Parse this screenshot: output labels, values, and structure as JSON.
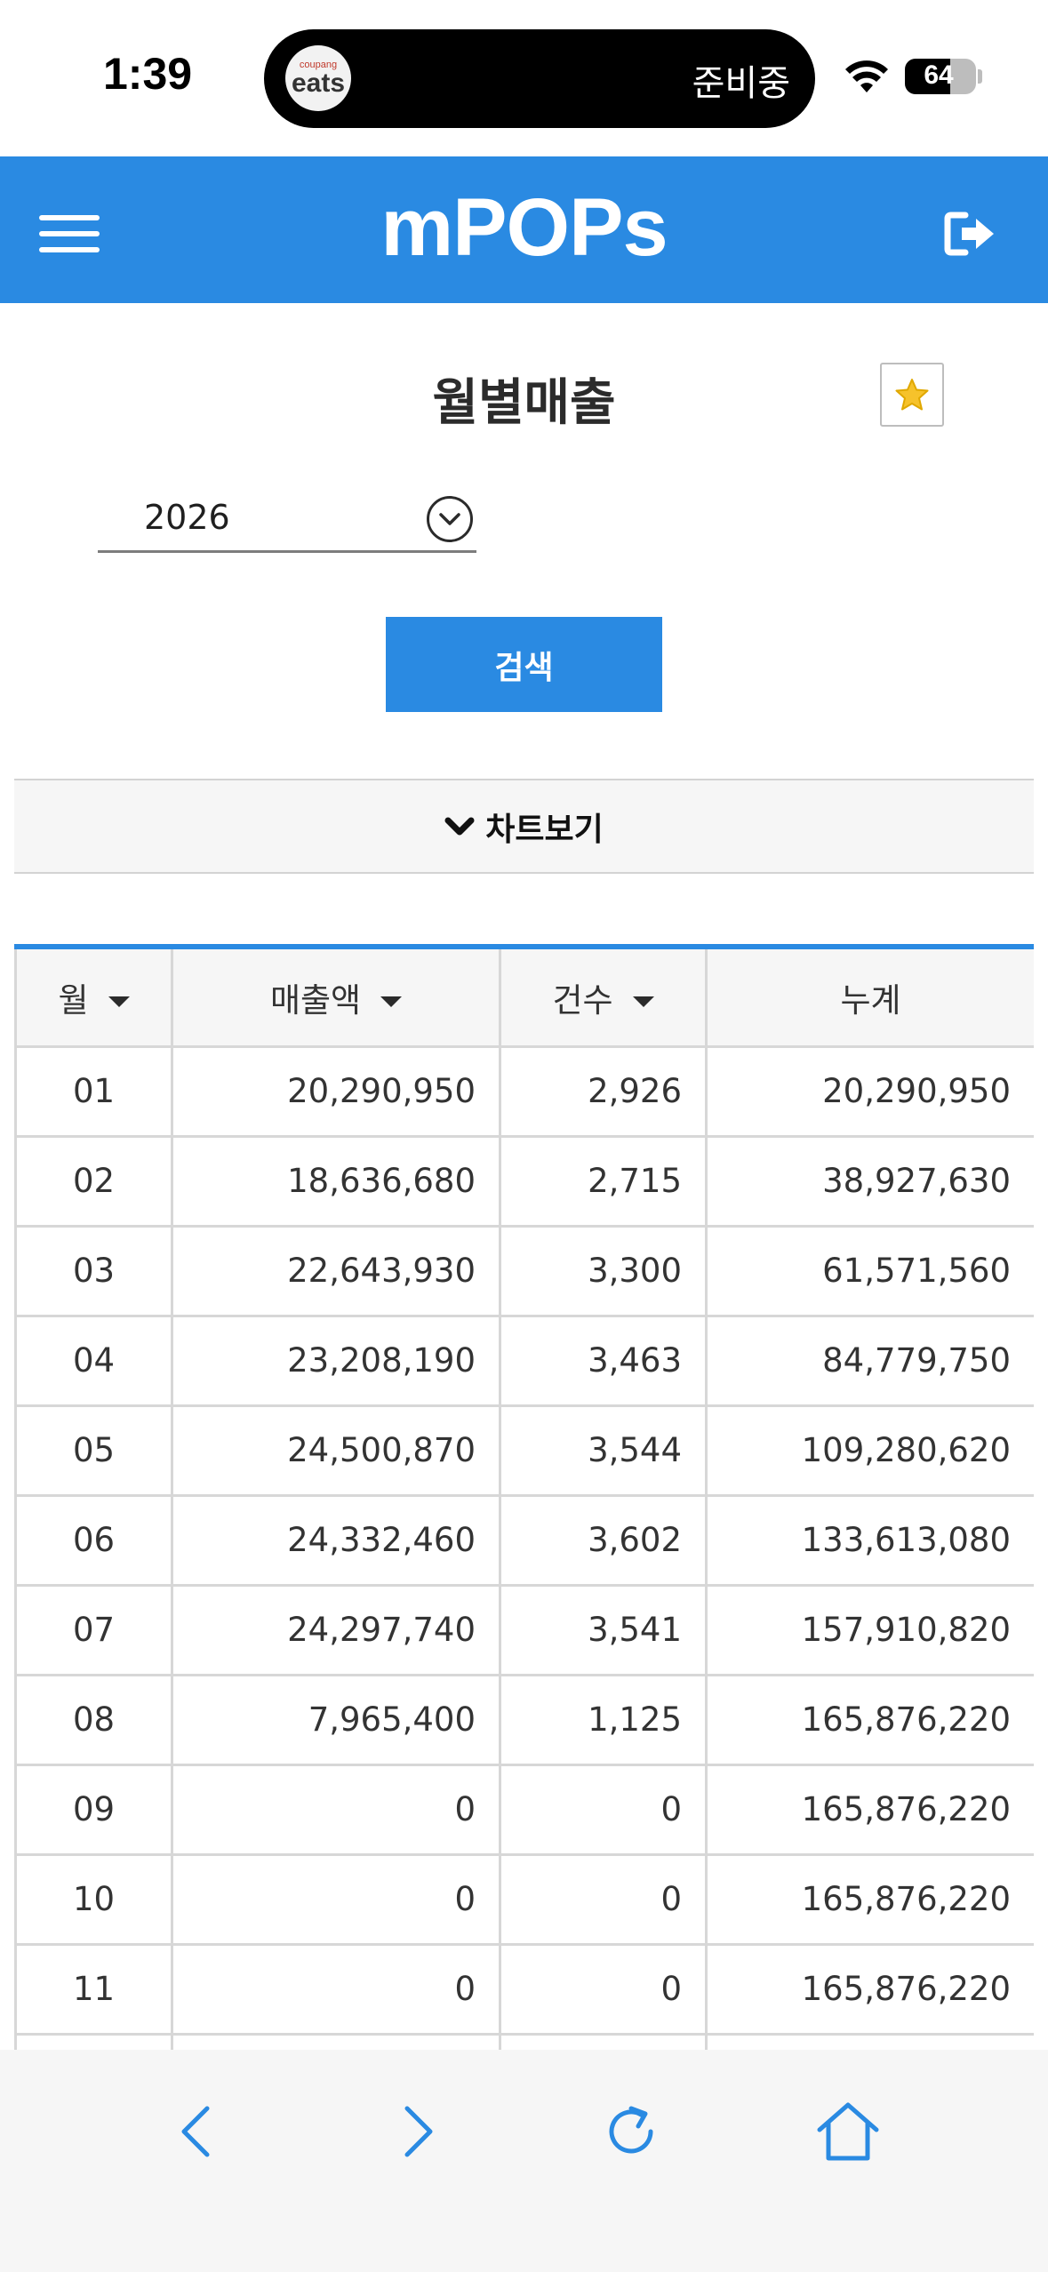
{
  "status_bar": {
    "time": "1:39",
    "island_logo_top": "coupang",
    "island_logo_bottom": "eats",
    "island_text": "준비중",
    "battery": "64",
    "battery_level": 0.64
  },
  "header": {
    "title": "mPOPs",
    "menu_icon": "hamburger-menu-icon",
    "logout_icon": "logout-icon",
    "color": "#2a8ae2"
  },
  "page": {
    "title": "월별매출",
    "favorite_icon": "star-icon"
  },
  "filter": {
    "year": "2026",
    "search_label": "검색"
  },
  "chart_toggle": {
    "label": "차트보기"
  },
  "table": {
    "headers": [
      "월",
      "매출액",
      "건수",
      "누계"
    ],
    "rows": [
      [
        "01",
        "20,290,950",
        "2,926",
        "20,290,950"
      ],
      [
        "02",
        "18,636,680",
        "2,715",
        "38,927,630"
      ],
      [
        "03",
        "22,643,930",
        "3,300",
        "61,571,560"
      ],
      [
        "04",
        "23,208,190",
        "3,463",
        "84,779,750"
      ],
      [
        "05",
        "24,500,870",
        "3,544",
        "109,280,620"
      ],
      [
        "06",
        "24,332,460",
        "3,602",
        "133,613,080"
      ],
      [
        "07",
        "24,297,740",
        "3,541",
        "157,910,820"
      ],
      [
        "08",
        "7,965,400",
        "1,125",
        "165,876,220"
      ],
      [
        "09",
        "0",
        "0",
        "165,876,220"
      ],
      [
        "10",
        "0",
        "0",
        "165,876,220"
      ],
      [
        "11",
        "0",
        "0",
        "165,876,220"
      ],
      [
        "",
        "",
        "",
        ""
      ]
    ]
  },
  "toolbar": {
    "icons": [
      "back-icon",
      "forward-icon",
      "reload-icon",
      "home-icon"
    ],
    "color": "#2a8ae2"
  }
}
